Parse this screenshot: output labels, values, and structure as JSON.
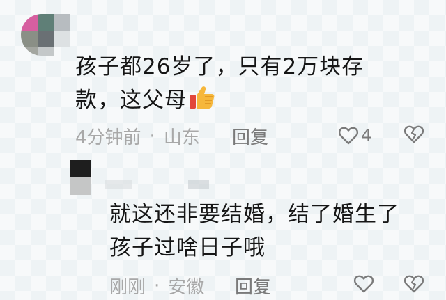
{
  "comments": [
    {
      "text_line1": "孩子都26岁了，只有2万块存",
      "text_line2": "款，这父母",
      "emoji": "thumbs-up",
      "time": "4分钟前",
      "location": "山东",
      "reply_label": "回复",
      "likes": "4"
    },
    {
      "text_line1": "就这还非要结婚，结了婚生了",
      "text_line2": "孩子过啥日子哦",
      "time": "刚刚",
      "location": "安徽",
      "reply_label": "回复"
    }
  ],
  "separator": "·",
  "colors": {
    "text": "#161616",
    "meta": "#a8a8a8",
    "action": "#7a7a7a",
    "thumb": "#f6b73c"
  },
  "icons": [
    "heart-outline-icon",
    "broken-heart-icon",
    "thumbs-up-emoji"
  ]
}
